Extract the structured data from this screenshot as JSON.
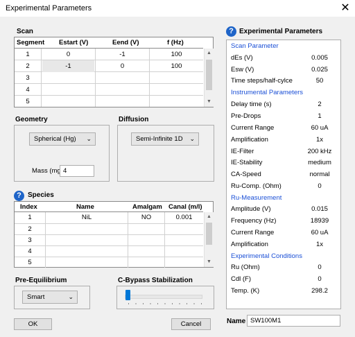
{
  "window": {
    "title": "Experimental Parameters",
    "close": "✕"
  },
  "scan": {
    "title": "Scan",
    "headers": [
      "Segment",
      "Estart (V)",
      "Eend (V)",
      "f (Hz)"
    ],
    "rows": [
      [
        "1",
        "0",
        "-1",
        "100"
      ],
      [
        "2",
        "-1",
        "0",
        "100"
      ],
      [
        "3",
        "",
        "",
        ""
      ],
      [
        "4",
        "",
        "",
        ""
      ],
      [
        "5",
        "",
        "",
        ""
      ]
    ]
  },
  "geometry": {
    "title": "Geometry",
    "selected": "Spherical (Hg)",
    "mass_label": "Mass (mg)",
    "mass_value": "4"
  },
  "diffusion": {
    "title": "Diffusion",
    "selected": "Semi-Infinite 1D"
  },
  "species": {
    "title": "Species",
    "help": "?",
    "headers": [
      "Index",
      "Name",
      "Amalgam",
      "Canal (m/l)"
    ],
    "rows": [
      [
        "1",
        "NiL",
        "NO",
        "0.001"
      ],
      [
        "2",
        "",
        "",
        ""
      ],
      [
        "3",
        "",
        "",
        ""
      ],
      [
        "4",
        "",
        "",
        ""
      ],
      [
        "5",
        "",
        "",
        ""
      ]
    ]
  },
  "pre_equilibrium": {
    "title": "Pre-Equilibrium",
    "selected": "Smart"
  },
  "cbypass": {
    "title": "C-Bypass Stabilization"
  },
  "buttons": {
    "ok": "OK",
    "cancel": "Cancel"
  },
  "experimental": {
    "title": "Experimental Parameters",
    "help": "?",
    "sections": [
      {
        "header": "Scan Parameter",
        "rows": [
          [
            "dEs (V)",
            "0.005"
          ],
          [
            "Esw (V)",
            "0.025"
          ],
          [
            "Time steps/half-cylce",
            "50"
          ]
        ]
      },
      {
        "header": "Instrumental Parameters",
        "rows": [
          [
            "Delay time (s)",
            "2"
          ],
          [
            "Pre-Drops",
            "1"
          ],
          [
            "Current Range",
            "60 uA"
          ],
          [
            "Amplification",
            "1x"
          ],
          [
            "IE-Filter",
            "200 kHz"
          ],
          [
            "IE-Stability",
            "medium"
          ],
          [
            "CA-Speed",
            "normal"
          ],
          [
            "Ru-Comp. (Ohm)",
            "0"
          ]
        ]
      },
      {
        "header": "Ru-Measurement",
        "rows": [
          [
            "Amplitude (V)",
            "0.015"
          ],
          [
            "Frequency (Hz)",
            "18939"
          ],
          [
            "Current Range",
            "60 uA"
          ],
          [
            "Amplification",
            "1x"
          ]
        ]
      },
      {
        "header": "Experimental Conditions",
        "rows": [
          [
            "Ru (Ohm)",
            "0"
          ],
          [
            "Cdl (F)",
            "0"
          ],
          [
            "Temp. (K)",
            "298.2"
          ]
        ]
      }
    ]
  },
  "name_field": {
    "label": "Name",
    "value": "SW100M1"
  }
}
